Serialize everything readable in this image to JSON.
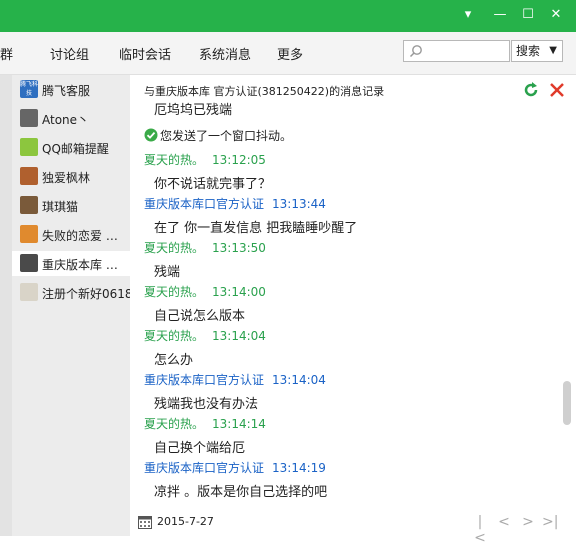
{
  "nav": {
    "group_label": "群",
    "tabs": [
      "讨论组",
      "临时会话",
      "系统消息",
      "更多"
    ],
    "search_placeholder": "",
    "search_button": "搜索"
  },
  "contacts": [
    {
      "name": "腾飞客服",
      "avatar_text": "腾飞科技",
      "color": "#2f6fc0"
    },
    {
      "name": "Atone丶",
      "color": "#666666"
    },
    {
      "name": "QQ邮箱提醒",
      "color": "#8cc63e"
    },
    {
      "name": "独爱枫林",
      "color": "#b0602e"
    },
    {
      "name": "琪琪猫",
      "color": "#7a5a3a"
    },
    {
      "name": "失败的恋爱 …",
      "color": "#e08a2e"
    },
    {
      "name": "重庆版本库 …",
      "color": "#4a4a4a",
      "active": true
    },
    {
      "name": "注册个新好0618",
      "color": "#d9d4c8"
    }
  ],
  "history": {
    "title": "与重庆版本库  官方认证(381250422)的消息记录",
    "top_partial": "厄坞坞已残端",
    "shake_notice": "您发送了一个窗口抖动。",
    "date": "2015-7-27"
  },
  "messages": [
    {
      "sender": "夏天的热。",
      "time": "13:12:05",
      "text": "你不说话就完事了？",
      "side": "me"
    },
    {
      "sender": "重庆版本库口官方认证",
      "time": "13:13:44",
      "text": "在了 你一直发信息 把我瞌睡吵醒了",
      "side": "them"
    },
    {
      "sender": "夏天的热。",
      "time": "13:13:50",
      "text": "残端",
      "side": "me"
    },
    {
      "sender": "夏天的热。",
      "time": "13:14:00",
      "text": "自己说怎么版本",
      "side": "me"
    },
    {
      "sender": "夏天的热。",
      "time": "13:14:04",
      "text": "怎么办",
      "side": "me"
    },
    {
      "sender": "重庆版本库口官方认证",
      "time": "13:14:04",
      "text": "残端我也没有办法",
      "side": "them"
    },
    {
      "sender": "夏天的热。",
      "time": "13:14:14",
      "text": "自己换个端给厄",
      "side": "me"
    },
    {
      "sender": "重庆版本库口官方认证",
      "time": "13:14:19",
      "text": "凉拌 。版本是你自己选择的吧",
      "side": "them"
    }
  ],
  "colors": {
    "titlebar": "#26b24a",
    "me": "#2aa14d",
    "them": "#1a62c6"
  }
}
